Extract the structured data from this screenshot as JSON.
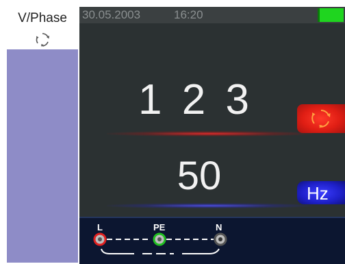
{
  "sidebar": {
    "mode_label": "V/Phase",
    "mode_icon": "phase-rotation-icon"
  },
  "status_bar": {
    "date": "30.05.2003",
    "time": "16:20",
    "battery_icon": "battery-icon",
    "battery_level": 1.0,
    "battery_color": "#1fd51f"
  },
  "main": {
    "primary_reading": "1 2 3",
    "secondary_reading": "50",
    "phase_badge_icon": "phase-rotation-icon",
    "unit_label": "Hz"
  },
  "connection": {
    "terminals": [
      {
        "label": "L",
        "color": "#e02020"
      },
      {
        "label": "PE",
        "color": "#20c020"
      },
      {
        "label": "N",
        "color": "#888888"
      }
    ]
  },
  "colors": {
    "sidebar": "#8e8cc7",
    "screen_bg": "#2b3132",
    "badge_red": "#e01e14",
    "badge_blue": "#1e20c8"
  }
}
